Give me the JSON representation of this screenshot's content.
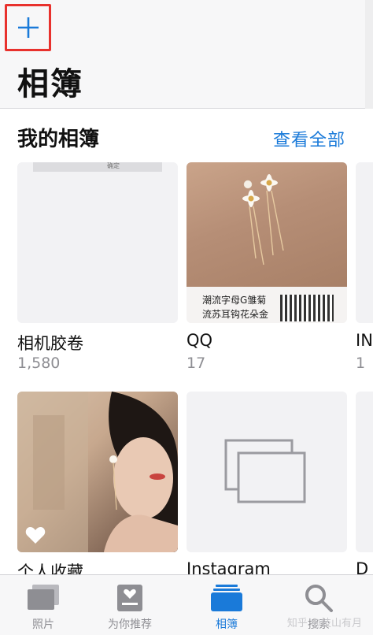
{
  "header": {
    "title": "相簿",
    "add_icon": "plus-icon"
  },
  "section": {
    "title": "我的相簿",
    "see_all": "查看全部"
  },
  "albums": [
    {
      "name": "相机胶卷",
      "count": "1,580",
      "thumb_text": "确定"
    },
    {
      "name": "QQ",
      "count": "17",
      "caption_line1": "潮流字母G雏菊",
      "caption_line2": "流苏耳钩花朵金"
    },
    {
      "name": "IN",
      "count": "1"
    },
    {
      "name": "个人收藏",
      "favorite_icon": "heart-icon"
    },
    {
      "name": "Instagram",
      "placeholder_icon": "stacked-photos-icon"
    },
    {
      "name": "D"
    }
  ],
  "tabbar": {
    "tabs": [
      {
        "label": "照片",
        "icon": "photos-icon",
        "active": false
      },
      {
        "label": "为你推荐",
        "icon": "for-you-icon",
        "active": false
      },
      {
        "label": "相簿",
        "icon": "albums-icon",
        "active": true
      },
      {
        "label": "搜索",
        "icon": "search-icon",
        "active": false
      }
    ],
    "watermark": "知乎 @技山有月"
  },
  "colors": {
    "accent": "#1a7ad9",
    "highlight_box": "#e8312d",
    "secondary_text": "#8e8e93"
  }
}
